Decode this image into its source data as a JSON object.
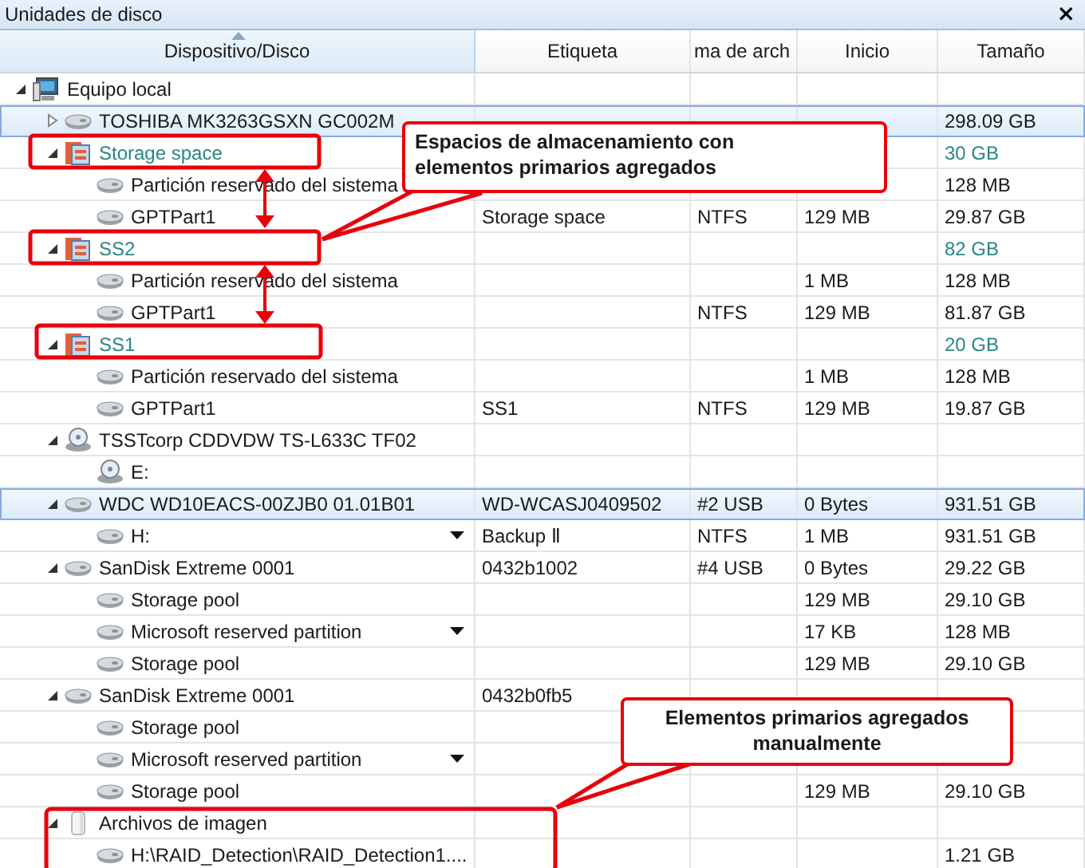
{
  "panel": {
    "title": "Unidades de disco",
    "close": "×"
  },
  "columns": [
    {
      "label": "Dispositivo/Disco",
      "sorted": true
    },
    {
      "label": "Etiqueta",
      "sorted": false
    },
    {
      "label": "ma de arch",
      "sorted": false
    },
    {
      "label": "Inicio",
      "sorted": false
    },
    {
      "label": "Tamaño",
      "sorted": false
    }
  ],
  "tree": [
    {
      "kind": "computer",
      "name": "Equipo local",
      "expanded": true,
      "selected": false,
      "children": [
        {
          "kind": "disk",
          "name": "TOSHIBA MK3263GSXN GC002M",
          "expanded": false,
          "selected": true,
          "size": "298.09 GB"
        },
        {
          "kind": "storage_space",
          "name": "Storage space",
          "expanded": true,
          "selected": false,
          "size": "30 GB",
          "children": [
            {
              "kind": "partition",
              "name": "Partición reservado del sistema",
              "selected": false,
              "size": "128 MB"
            },
            {
              "kind": "partition",
              "name": "GPTPart1",
              "selected": false,
              "label": "Storage space",
              "fs": "NTFS",
              "start": "129 MB",
              "size": "29.87 GB"
            }
          ]
        },
        {
          "kind": "storage_space",
          "name": "SS2",
          "expanded": true,
          "selected": false,
          "size": "82 GB",
          "children": [
            {
              "kind": "partition",
              "name": "Partición reservado del sistema",
              "selected": false,
              "start": "1 MB",
              "size": "128 MB"
            },
            {
              "kind": "partition",
              "name": "GPTPart1",
              "selected": false,
              "fs": "NTFS",
              "start": "129 MB",
              "size": "81.87 GB"
            }
          ]
        },
        {
          "kind": "storage_space",
          "name": "SS1",
          "expanded": true,
          "selected": false,
          "size": "20 GB",
          "children": [
            {
              "kind": "partition",
              "name": "Partición reservado del sistema",
              "selected": false,
              "start": "1 MB",
              "size": "128 MB"
            },
            {
              "kind": "partition",
              "name": "GPTPart1",
              "selected": false,
              "label": "SS1",
              "fs": "NTFS",
              "start": "129 MB",
              "size": "19.87 GB"
            }
          ]
        },
        {
          "kind": "cdrom",
          "name": "TSSTcorp CDDVDW TS-L633C TF02",
          "expanded": true,
          "selected": false,
          "children": [
            {
              "kind": "cdrom",
              "name": "E:",
              "selected": false
            }
          ]
        },
        {
          "kind": "disk",
          "name": "WDC WD10EACS-00ZJB0 01.01B01",
          "expanded": true,
          "selected": true,
          "label": "WD-WCASJ0409502",
          "fs": "#2 USB",
          "start": "0 Bytes",
          "size": "931.51 GB",
          "children": [
            {
              "kind": "partition",
              "name": "H:",
              "dropdown": true,
              "selected": false,
              "label": "Backup Ⅱ",
              "fs": "NTFS",
              "start": "1 MB",
              "size": "931.51 GB"
            }
          ]
        },
        {
          "kind": "disk",
          "name": "SanDisk Extreme 0001",
          "expanded": true,
          "selected": false,
          "label": "0432b1002",
          "fs": "#4 USB",
          "start": "0 Bytes",
          "size": "29.22 GB",
          "children": [
            {
              "kind": "partition",
              "name": "Storage pool",
              "selected": false,
              "start": "129 MB",
              "size": "29.10 GB"
            },
            {
              "kind": "partition",
              "name": "Microsoft reserved partition",
              "dropdown": true,
              "selected": false,
              "start": "17 KB",
              "size": "128 MB"
            },
            {
              "kind": "partition",
              "name": "Storage pool",
              "selected": false,
              "start": "129 MB",
              "size": "29.10 GB"
            }
          ]
        },
        {
          "kind": "disk",
          "name": "SanDisk Extreme 0001",
          "expanded": true,
          "selected": false,
          "label": "0432b0fb5",
          "children": [
            {
              "kind": "partition",
              "name": "Storage pool",
              "selected": false
            },
            {
              "kind": "partition",
              "name": "Microsoft reserved partition",
              "dropdown": true,
              "selected": false
            },
            {
              "kind": "partition",
              "name": "Storage pool",
              "selected": false,
              "start": "129 MB",
              "size": "29.10 GB"
            }
          ]
        },
        {
          "kind": "images",
          "name": "Archivos de imagen",
          "expanded": true,
          "selected": false,
          "children": [
            {
              "kind": "partition",
              "name": "H:\\RAID_Detection\\RAID_Detection1....",
              "selected": false,
              "size": "1.21 GB"
            }
          ]
        }
      ]
    }
  ],
  "callouts": [
    {
      "text": "Espacios de almacenamiento con\nelementos primarios agregados"
    },
    {
      "text": "Elementos primarios agregados\nmanualmente"
    }
  ]
}
